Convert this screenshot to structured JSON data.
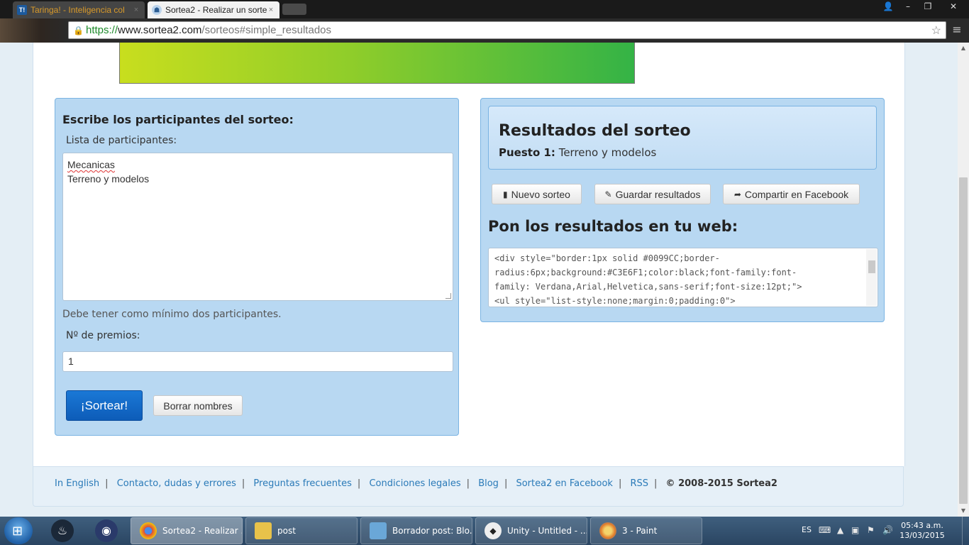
{
  "browser": {
    "tabs": [
      {
        "favicon_text": "T!",
        "title": "Taringa! - Inteligencia col",
        "close": "×"
      },
      {
        "favicon_text": "☗",
        "title": "Sortea2 - Realizar un sorte",
        "close": "×"
      }
    ],
    "window_controls": {
      "user": "👤",
      "minimize": "–",
      "restore": "❐",
      "close": "✕"
    },
    "address": {
      "https": "https://",
      "host": "www.sortea2.com",
      "path": "/sorteos#simple_resultados"
    },
    "star": "☆",
    "menu": "≡"
  },
  "left_panel": {
    "heading": "Escribe los participantes del sorteo:",
    "list_label": "Lista de participantes:",
    "participants": [
      "Mecanicas",
      "Terreno y modelos"
    ],
    "hint": "Debe tener como mínimo dos participantes.",
    "prizes_label": "Nº de premios:",
    "prizes_value": "1",
    "draw_button": "¡Sortear!",
    "clear_button": "Borrar nombres"
  },
  "right_panel": {
    "results_title": "Resultados del sorteo",
    "position_label": "Puesto 1:",
    "position_value": "Terreno y modelos",
    "new_button": "Nuevo sorteo",
    "save_button": "Guardar resultados",
    "share_button": "Compartir en Facebook",
    "web_heading": "Pon los resultados en tu web:",
    "code_lines": [
      "<div style=\"border:1px solid #0099CC;border-",
      "radius:6px;background:#C3E6F1;color:black;font-family:font-",
      "family: Verdana,Arial,Helvetica,sans-serif;font-size:12pt;\">",
      "<ul style=\"list-style:none;margin:0;padding:0\">"
    ]
  },
  "footer": {
    "links": [
      "In English",
      "Contacto, dudas y errores",
      "Preguntas frecuentes",
      "Condiciones legales",
      "Blog",
      "Sortea2 en Facebook",
      "RSS"
    ],
    "separator": "|",
    "copyright": "© 2008-2015 Sortea2"
  },
  "taskbar": {
    "tasks": [
      {
        "label": "Sortea2 - Realizar ...",
        "icon": "chrome-icon",
        "color": "#dd4b39"
      },
      {
        "label": "post",
        "icon": "folder-icon",
        "color": "#e8c24a"
      },
      {
        "label": "Borrador post: Blo...",
        "icon": "document-icon",
        "color": "#6aa7d8"
      },
      {
        "label": "Unity - Untitled - ...",
        "icon": "unity-icon",
        "color": "#333333"
      },
      {
        "label": "3 - Paint",
        "icon": "paint-icon",
        "color": "#e07a2a"
      }
    ],
    "language": "ES",
    "time": "05:43 a.m.",
    "date": "13/03/2015"
  },
  "colors": {
    "accent": "#0d5cb8",
    "panel": "#b8d8f2",
    "link": "#2a7ab8"
  }
}
